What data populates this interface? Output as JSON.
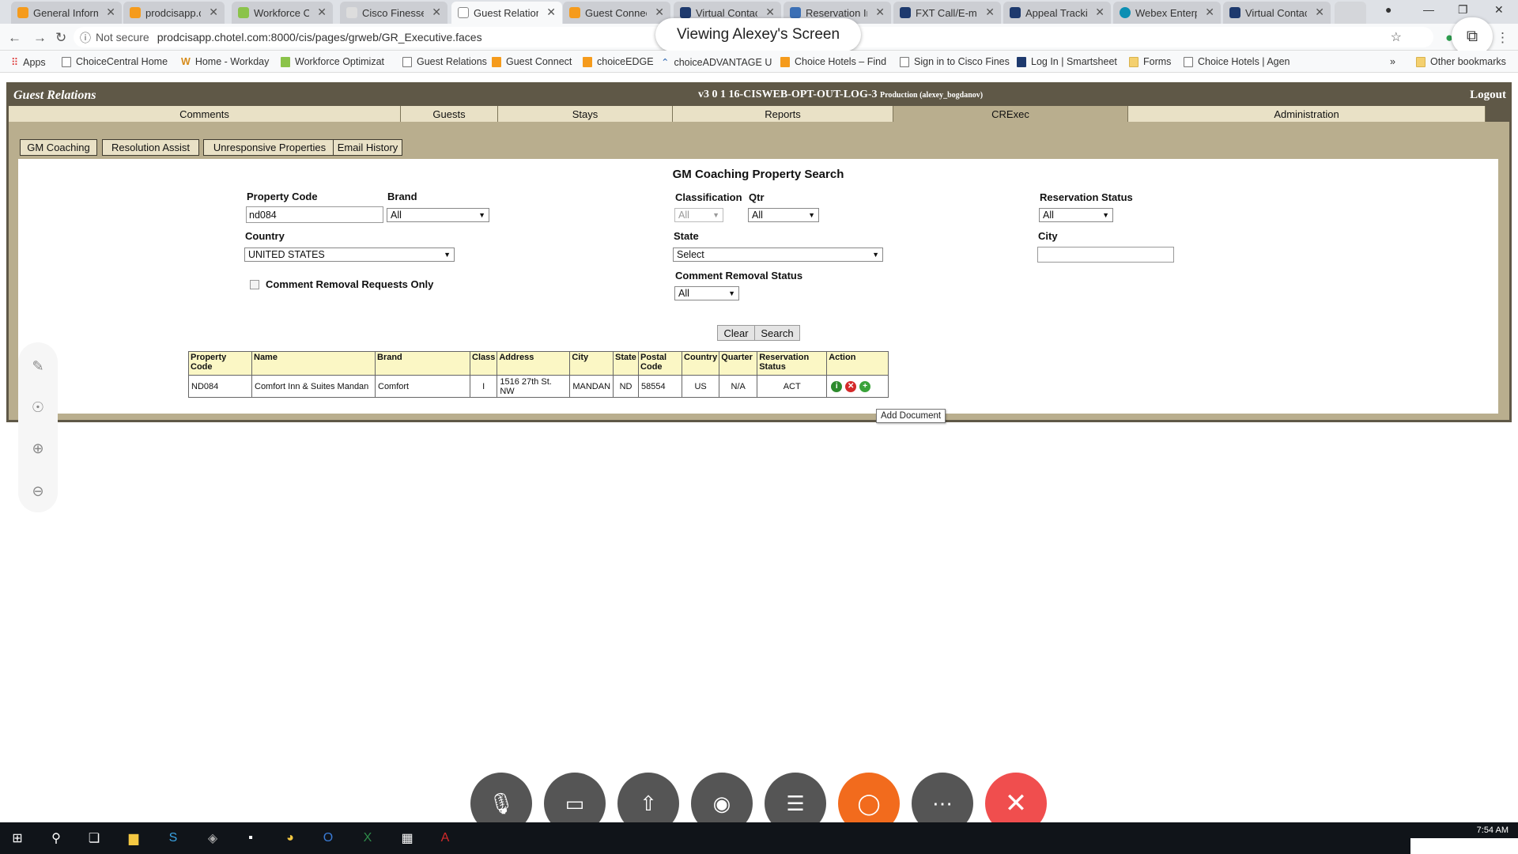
{
  "browser": {
    "tabs": [
      {
        "label": "General Inform",
        "color": "#f59b1c",
        "active": false
      },
      {
        "label": "prodcisapp.ch",
        "color": "#f59b1c",
        "active": false
      },
      {
        "label": "Workforce Opt",
        "color": "#8bc34a",
        "active": false
      },
      {
        "label": "Cisco Finesse",
        "color": "#cccccc",
        "active": false
      },
      {
        "label": "Guest Relation",
        "color": "#cccccc",
        "active": true
      },
      {
        "label": "Guest Connect",
        "color": "#f59b1c",
        "active": false
      },
      {
        "label": "Virtual Contact",
        "color": "#1e3a6e",
        "active": false
      },
      {
        "label": "Reservation Inf",
        "color": "#3b6fb5",
        "active": false
      },
      {
        "label": "FXT Call/E-mai",
        "color": "#1e3a6e",
        "active": false
      },
      {
        "label": "Appeal Trackin",
        "color": "#1e3a6e",
        "active": false
      },
      {
        "label": "Webex Enterpr",
        "color": "#0c8fb3",
        "active": false
      },
      {
        "label": "Virtual Contact",
        "color": "#1e3a6e",
        "active": false
      }
    ],
    "not_secure": "Not secure",
    "url": "prodcisapp.chotel.com:8000/cis/pages/grweb/GR_Executive.faces",
    "viewing_banner": "Viewing Alexey's Screen",
    "bookmarks": [
      "Apps",
      "ChoiceCentral Home",
      "Home - Workday",
      "Workforce Optimizat",
      "Guest Relations",
      "Guest Connect",
      "choiceEDGE",
      "choiceADVANTAGE U",
      "Choice Hotels – Find",
      "Sign in to Cisco Fines",
      "Log In | Smartsheet",
      "Forms",
      "Choice Hotels | Agen",
      "»",
      "Other bookmarks"
    ]
  },
  "app": {
    "name": "Guest Relations",
    "version": "v3 0 1 16-CISWEB-OPT-OUT-LOG-3",
    "env": "Production (alexey_bogdanov)",
    "logout": "Logout",
    "nav": [
      "Comments",
      "Guests",
      "Stays",
      "Reports",
      "CRExec",
      "Administration"
    ],
    "nav_active": "CRExec",
    "subnav": [
      "GM Coaching",
      "Resolution Assist",
      "Unresponsive Properties",
      "Email History"
    ]
  },
  "search": {
    "title": "GM Coaching Property Search",
    "property_code_label": "Property Code",
    "property_code_value": "nd084",
    "brand_label": "Brand",
    "brand_value": "All",
    "classification_label": "Classification",
    "classification_value": "All",
    "qtr_label": "Qtr",
    "qtr_value": "All",
    "reservation_status_label": "Reservation Status",
    "reservation_status_value": "All",
    "country_label": "Country",
    "country_value": "UNITED STATES",
    "state_label": "State",
    "state_value": "Select",
    "city_label": "City",
    "city_value": "",
    "comment_removal_only_label": "Comment Removal Requests Only",
    "comment_removal_status_label": "Comment Removal Status",
    "comment_removal_status_value": "All",
    "clear_label": "Clear",
    "search_label": "Search"
  },
  "results": {
    "headers": [
      "Property Code",
      "Name",
      "Brand",
      "Class",
      "Address",
      "City",
      "State",
      "Postal Code",
      "Country",
      "Quarter",
      "Reservation Status",
      "Action"
    ],
    "rows": [
      {
        "property_code": "ND084",
        "name": "Comfort Inn & Suites Mandan",
        "brand": "Comfort",
        "class": "I",
        "address": "1516 27th St. NW",
        "city": "MANDAN",
        "state": "ND",
        "postal_code": "58554",
        "country": "US",
        "quarter": "N/A",
        "reservation_status": "ACT"
      }
    ],
    "tooltip": "Add Document"
  },
  "taskbar": {
    "clock": "7:54 AM"
  }
}
